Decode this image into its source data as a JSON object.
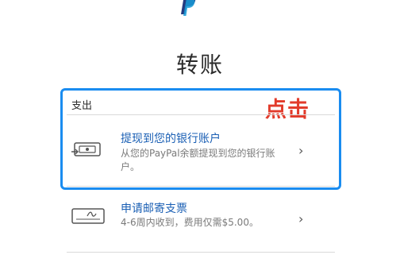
{
  "header": {
    "title": "转账",
    "logo_icon": "paypal-logo"
  },
  "annotation": {
    "text": "点击",
    "color": "#e23b2b"
  },
  "highlight_color": "#1a8cf0",
  "section": {
    "label": "支出"
  },
  "options": [
    {
      "title": "提现到您的银行账户",
      "description": "从您的PayPal余额提现到您的银行账户。",
      "icon": "bank-transfer-icon"
    },
    {
      "title": "申请邮寄支票",
      "description": "4-6周内收到，费用仅需$5.00。",
      "icon": "check-icon"
    }
  ]
}
